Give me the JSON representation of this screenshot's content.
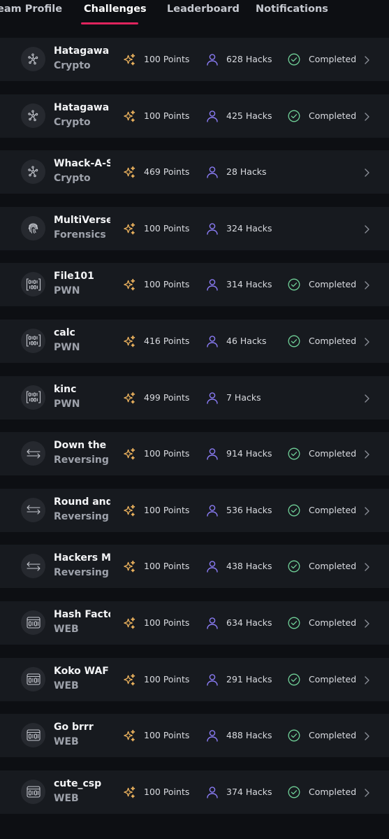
{
  "tabs": [
    {
      "label": "eam Profile",
      "active": false
    },
    {
      "label": "Challenges",
      "active": true
    },
    {
      "label": "Leaderboard",
      "active": false
    },
    {
      "label": "Notifications",
      "active": false
    }
  ],
  "colors": {
    "accent": "#e0245e",
    "points_icon": "#f4b860",
    "hacks_icon": "#8b7cf6",
    "completed_icon": "#6fcf97"
  },
  "challenges": [
    {
      "name": "Hatagawa I",
      "category": "Crypto",
      "icon": "crypto-network-icon",
      "points": "100 Points",
      "hacks": "628 Hacks",
      "status": "Completed"
    },
    {
      "name": "Hatagawa II",
      "category": "Crypto",
      "icon": "crypto-network-icon",
      "points": "100 Points",
      "hacks": "425 Hacks",
      "status": "Completed"
    },
    {
      "name": "Whack-A-Scalar",
      "category": "Crypto",
      "icon": "crypto-network-icon",
      "points": "469 Points",
      "hacks": "28 Hacks",
      "status": ""
    },
    {
      "name": "MultiVerse",
      "category": "Forensics",
      "icon": "fingerprint-icon",
      "points": "100 Points",
      "hacks": "324 Hacks",
      "status": ""
    },
    {
      "name": "File101",
      "category": "PWN",
      "icon": "binary-icon",
      "points": "100 Points",
      "hacks": "314 Hacks",
      "status": "Completed"
    },
    {
      "name": "calc",
      "category": "PWN",
      "icon": "binary-icon",
      "points": "416 Points",
      "hacks": "46 Hacks",
      "status": "Completed"
    },
    {
      "name": "kinc",
      "category": "PWN",
      "icon": "binary-icon",
      "points": "499 Points",
      "hacks": "7 Hacks",
      "status": ""
    },
    {
      "name": "Down the Rabbit Hole",
      "category": "Reversing",
      "icon": "swap-arrows-icon",
      "points": "100 Points",
      "hacks": "914 Hacks",
      "status": "Completed"
    },
    {
      "name": "Round and round",
      "category": "Reversing",
      "icon": "swap-arrows-icon",
      "points": "100 Points",
      "hacks": "536 Hacks",
      "status": "Completed"
    },
    {
      "name": "Hackers Mirror",
      "category": "Reversing",
      "icon": "swap-arrows-icon",
      "points": "100 Points",
      "hacks": "438 Hacks",
      "status": "Completed"
    },
    {
      "name": "Hash Factory",
      "category": "WEB",
      "icon": "browser-code-icon",
      "points": "100 Points",
      "hacks": "634 Hacks",
      "status": "Completed"
    },
    {
      "name": "Koko WAF",
      "category": "WEB",
      "icon": "browser-code-icon",
      "points": "100 Points",
      "hacks": "291 Hacks",
      "status": "Completed"
    },
    {
      "name": "Go brrr",
      "category": "WEB",
      "icon": "browser-code-icon",
      "points": "100 Points",
      "hacks": "488 Hacks",
      "status": "Completed"
    },
    {
      "name": "cute_csp",
      "category": "WEB",
      "icon": "browser-code-icon",
      "points": "100 Points",
      "hacks": "374 Hacks",
      "status": "Completed"
    }
  ]
}
